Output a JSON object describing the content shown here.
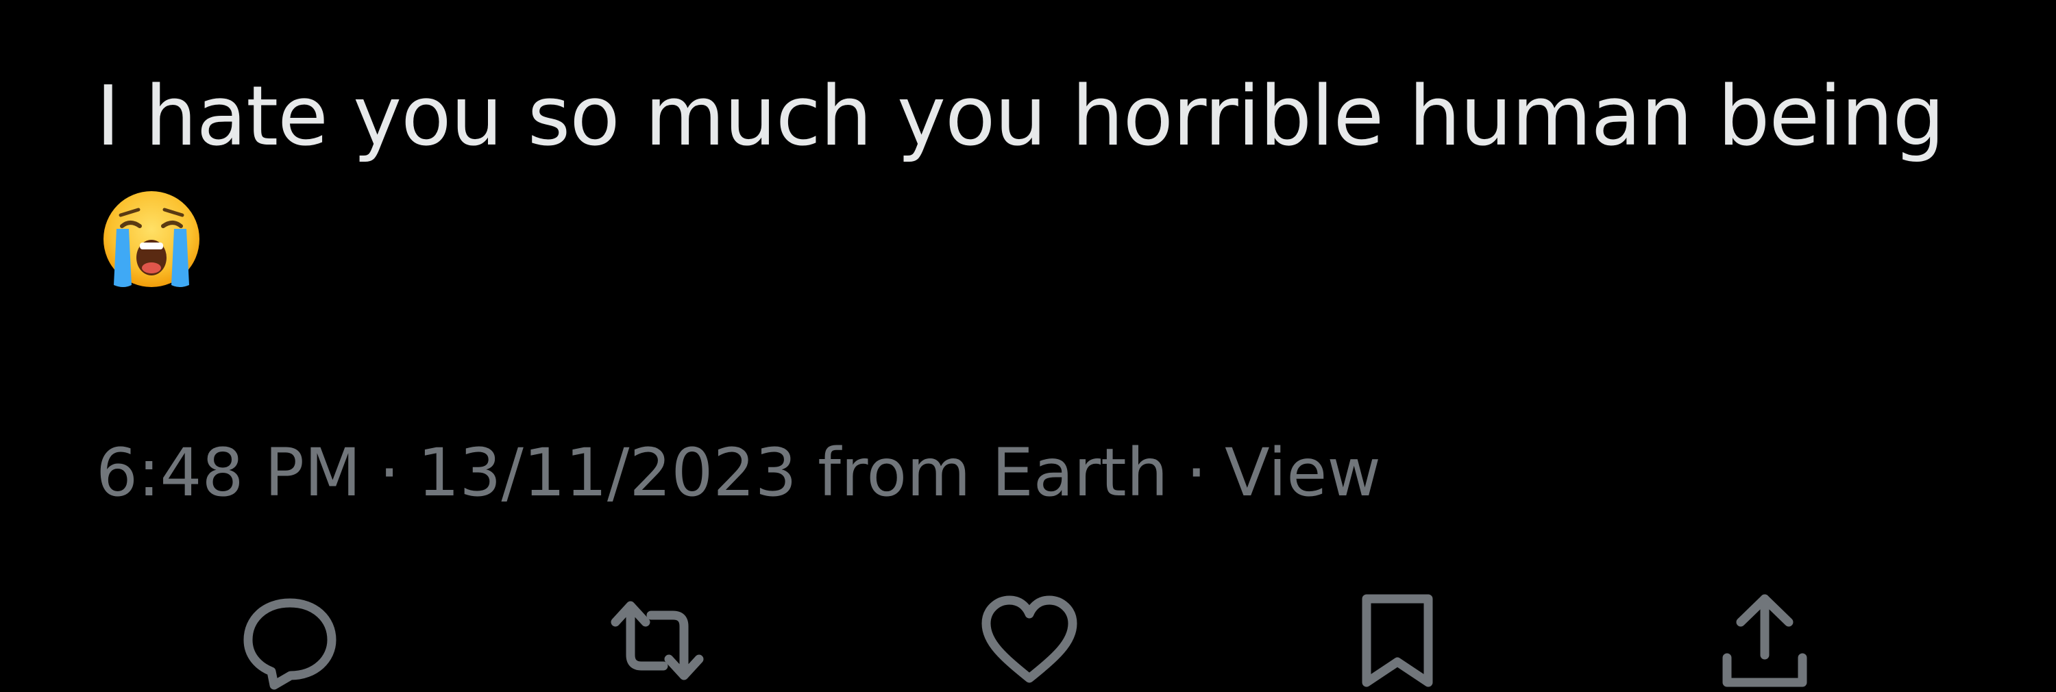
{
  "tweet": {
    "text": "I hate you so much you horrible human being",
    "emoji": "loudly-crying-face",
    "time": "6:48 PM",
    "date": "13/11/2023 from Earth",
    "separator": "·",
    "view_label": "View"
  },
  "actions": [
    {
      "name": "reply",
      "icon": "reply-bubble-icon"
    },
    {
      "name": "repost",
      "icon": "repost-arrows-icon"
    },
    {
      "name": "like",
      "icon": "heart-icon"
    },
    {
      "name": "bookmark",
      "icon": "bookmark-icon"
    },
    {
      "name": "share",
      "icon": "share-upload-icon"
    }
  ],
  "colors": {
    "background": "#000000",
    "text": "#e7e9ea",
    "secondary": "#71767b"
  }
}
